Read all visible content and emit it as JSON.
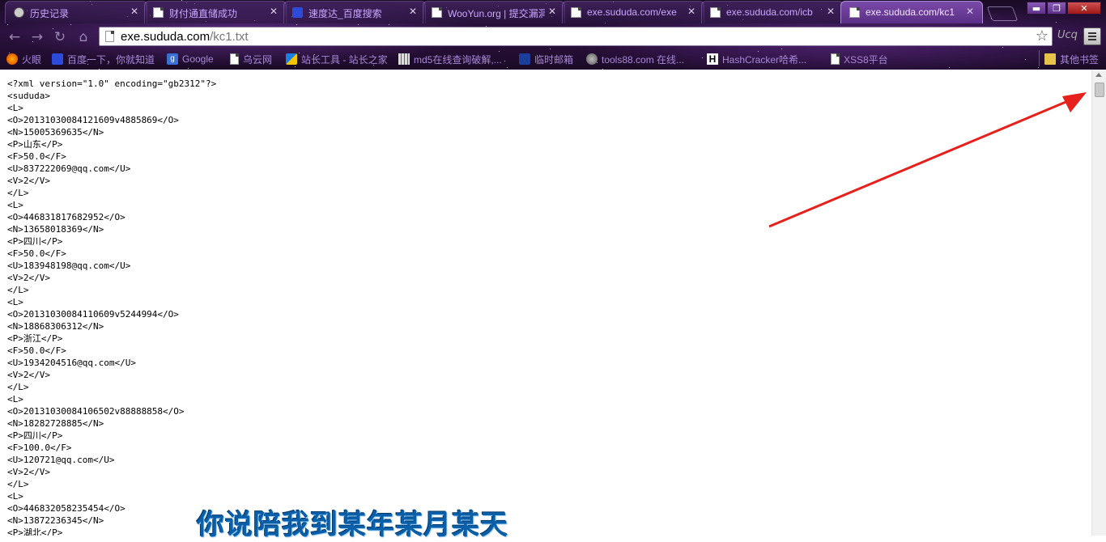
{
  "tabs": [
    {
      "title": "历史记录",
      "icon": "history-clock-icon",
      "active": false
    },
    {
      "title": "财付通直储成功",
      "icon": "page-icon",
      "active": false
    },
    {
      "title": "速度达_百度搜索",
      "icon": "baidu-paw-icon",
      "active": false
    },
    {
      "title": "WooYun.org | 提交漏洞",
      "icon": "page-icon",
      "active": false
    },
    {
      "title": "exe.sududa.com/exe",
      "icon": "page-icon",
      "active": false
    },
    {
      "title": "exe.sududa.com/icb",
      "icon": "page-icon",
      "active": false
    },
    {
      "title": "exe.sududa.com/kc1",
      "icon": "page-icon",
      "active": true
    }
  ],
  "window_buttons": {
    "minimize": "▬",
    "restore": "❐",
    "close": "✕"
  },
  "toolbar": {
    "back": "←",
    "forward": "→",
    "reload": "↻",
    "home": "⌂",
    "url_host": "exe.sududa.com",
    "url_path": "/kc1.txt",
    "bookmark_star": "☆",
    "extension_label": "Ucq"
  },
  "bookmarks": [
    {
      "label": "火眼",
      "icon": "firefox-icon"
    },
    {
      "label": "百度一下，你就知道",
      "icon": "baidu-paw-icon"
    },
    {
      "label": "Google",
      "icon": "google-icon"
    },
    {
      "label": "乌云网",
      "icon": "page-icon"
    },
    {
      "label": "站长工具 - 站长之家",
      "icon": "chinaz-icon"
    },
    {
      "label": "md5在线查询破解,...",
      "icon": "grid-icon"
    },
    {
      "label": "临时邮箱",
      "icon": "mail-icon"
    },
    {
      "label": "tools88.com 在线...",
      "icon": "globe-icon"
    },
    {
      "label": "HashCracker哈希...",
      "icon": "h-icon"
    },
    {
      "label": "XSS8平台",
      "icon": "page-icon"
    }
  ],
  "other_bookmarks": "其他书签",
  "file_lines": [
    "<?xml version=\"1.0\" encoding=\"gb2312\"?>",
    "<sududa>",
    "<L>",
    "<O>20131030084121609v4885869</O>",
    "<N>15005369635</N>",
    "<P>山东</P>",
    "<F>50.0</F>",
    "<U>837222069@qq.com</U>",
    "<V>2</V>",
    "</L>",
    "<L>",
    "<O>446831817682952</O>",
    "<N>13658018369</N>",
    "<P>四川</P>",
    "<F>50.0</F>",
    "<U>183948198@qq.com</U>",
    "<V>2</V>",
    "</L>",
    "<L>",
    "<O>20131030084110609v5244994</O>",
    "<N>18868306312</N>",
    "<P>浙江</P>",
    "<F>50.0</F>",
    "<U>1934204516@qq.com</U>",
    "<V>2</V>",
    "</L>",
    "<L>",
    "<O>20131030084106502v88888858</O>",
    "<N>18282728885</N>",
    "<P>四川</P>",
    "<F>100.0</F>",
    "<U>120721@qq.com</U>",
    "<V>2</V>",
    "</L>",
    "<L>",
    "<O>446832058235454</O>",
    "<N>13872236345</N>",
    "<P>湖北</P>"
  ],
  "subtitle": "你说陪我到某年某月某天",
  "colors": {
    "annotation_arrow": "#e8201c",
    "subtitle": "#0b5fa8",
    "chrome_purple": "#2c1240"
  }
}
